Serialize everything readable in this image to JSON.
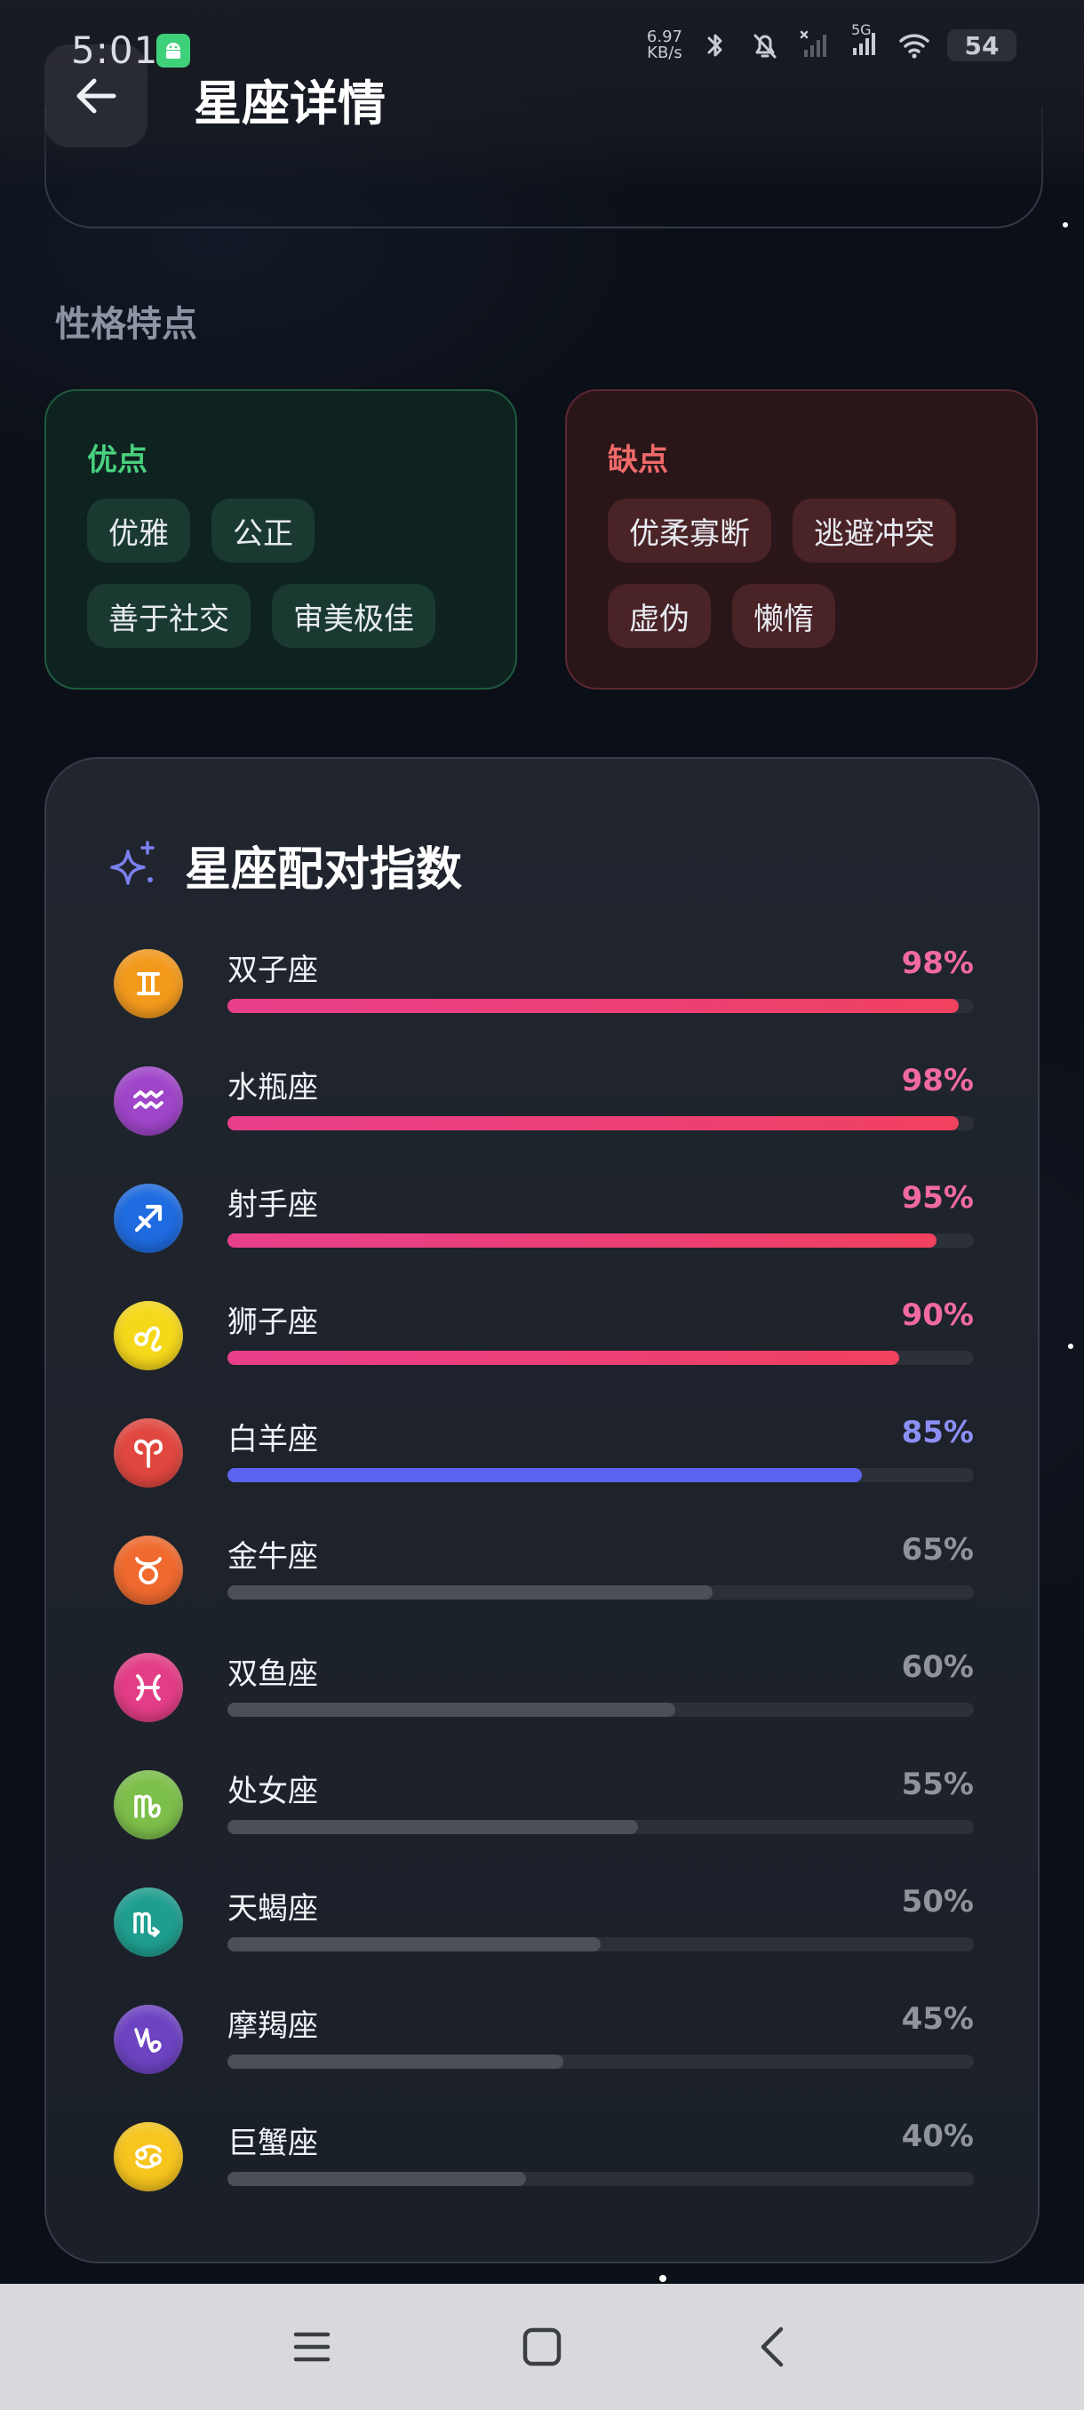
{
  "status_bar": {
    "time": "5:01",
    "net_speed_value": "6.97",
    "net_speed_unit": "KB/s",
    "signal_label": "5G",
    "battery": "54"
  },
  "header": {
    "title": "星座详情",
    "back_icon": "arrow-left-icon"
  },
  "section": {
    "title": "性格特点"
  },
  "traits": {
    "pros": {
      "title": "优点",
      "tags": [
        "优雅",
        "公正",
        "善于社交",
        "审美极佳"
      ]
    },
    "cons": {
      "title": "缺点",
      "tags": [
        "优柔寡断",
        "逃避冲突",
        "虚伪",
        "懒惰"
      ]
    }
  },
  "compat": {
    "title": "星座配对指数",
    "icon": "sparkle-icon",
    "rows": [
      {
        "name": "双子座",
        "pct_text": "98%",
        "value": 98,
        "icon": "gemini-icon",
        "circle": "#f39a1d",
        "tier": "high"
      },
      {
        "name": "水瓶座",
        "pct_text": "98%",
        "value": 98,
        "icon": "aquarius-icon",
        "circle": "#9f45c9",
        "tier": "high"
      },
      {
        "name": "射手座",
        "pct_text": "95%",
        "value": 95,
        "icon": "sagittarius-icon",
        "circle": "#1f6be0",
        "tier": "high"
      },
      {
        "name": "狮子座",
        "pct_text": "90%",
        "value": 90,
        "icon": "leo-icon",
        "circle": "#f6d81b",
        "tier": "high"
      },
      {
        "name": "白羊座",
        "pct_text": "85%",
        "value": 85,
        "icon": "aries-icon",
        "circle": "#e0473f",
        "tier": "good"
      },
      {
        "name": "金牛座",
        "pct_text": "65%",
        "value": 65,
        "icon": "taurus-icon",
        "circle": "#f06a2f",
        "tier": "normal"
      },
      {
        "name": "双鱼座",
        "pct_text": "60%",
        "value": 60,
        "icon": "pisces-icon",
        "circle": "#e33d86",
        "tier": "normal"
      },
      {
        "name": "处女座",
        "pct_text": "55%",
        "value": 55,
        "icon": "virgo-icon",
        "circle": "#7dbf4b",
        "tier": "normal"
      },
      {
        "name": "天蝎座",
        "pct_text": "50%",
        "value": 50,
        "icon": "scorpio-icon",
        "circle": "#1f9e8f",
        "tier": "normal"
      },
      {
        "name": "摩羯座",
        "pct_text": "45%",
        "value": 45,
        "icon": "capricorn-icon",
        "circle": "#6d43c2",
        "tier": "normal"
      },
      {
        "name": "巨蟹座",
        "pct_text": "40%",
        "value": 40,
        "icon": "cancer-icon",
        "circle": "#f7c51d",
        "tier": "normal"
      }
    ]
  },
  "colors": {
    "high_bar": "#ec3f73",
    "high_pct": "#f06aa0",
    "good_bar": "#5c63ee",
    "good_pct": "#8b8ff5",
    "normal_bar": "#4a4f58",
    "normal_pct": "#8e939c"
  },
  "navbar": {
    "menu_icon": "menu-icon",
    "home_icon": "home-square-icon",
    "back_icon": "chevron-left-icon"
  }
}
